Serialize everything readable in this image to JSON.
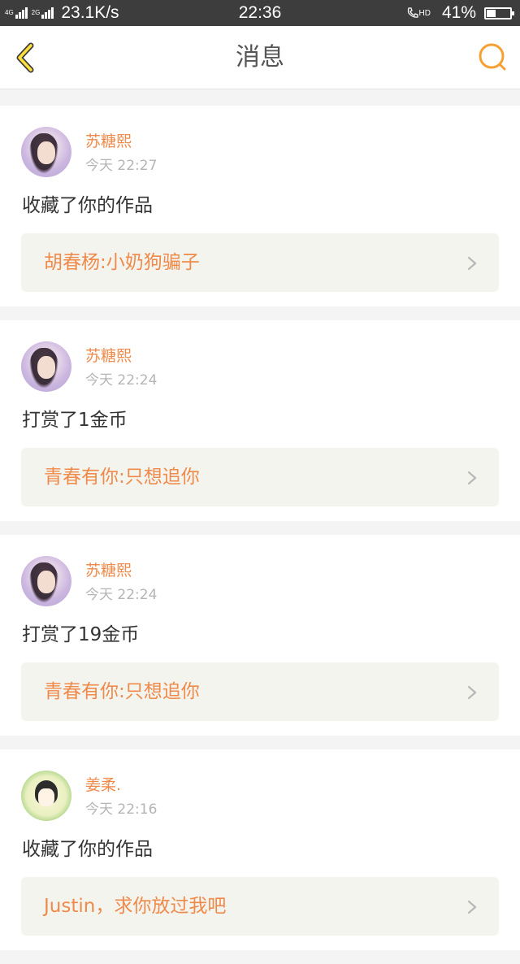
{
  "statusbar": {
    "net1": "4G",
    "net2": "4G",
    "net3": "2G",
    "speed": "23.1K/s",
    "time": "22:36",
    "call_label": "HD",
    "battery": "41%",
    "battery_level": 0.41
  },
  "navbar": {
    "title": "消息",
    "back_icon": "chevron-left-icon",
    "search_icon": "search-icon",
    "accent": "#f5a033"
  },
  "colors": {
    "accent_orange": "#ef8a4a",
    "card_bg": "#ffffff",
    "work_bg": "#f4f4ef",
    "page_bg": "#f4f4f4"
  },
  "messages": [
    {
      "user": "苏糖熙",
      "time": "今天 22:27",
      "action": "收藏了你的作品",
      "work": "胡春杨:小奶狗骗子",
      "avatar": "girl"
    },
    {
      "user": "苏糖熙",
      "time": "今天 22:24",
      "action": "打赏了1金币",
      "work": "青春有你:只想追你",
      "avatar": "girl"
    },
    {
      "user": "苏糖熙",
      "time": "今天 22:24",
      "action": "打赏了19金币",
      "work": "青春有你:只想追你",
      "avatar": "girl"
    },
    {
      "user": "姜柔.",
      "time": "今天 22:16",
      "action": "收藏了你的作品",
      "work": "Justin，求你放过我吧",
      "avatar": "cartoon"
    }
  ]
}
